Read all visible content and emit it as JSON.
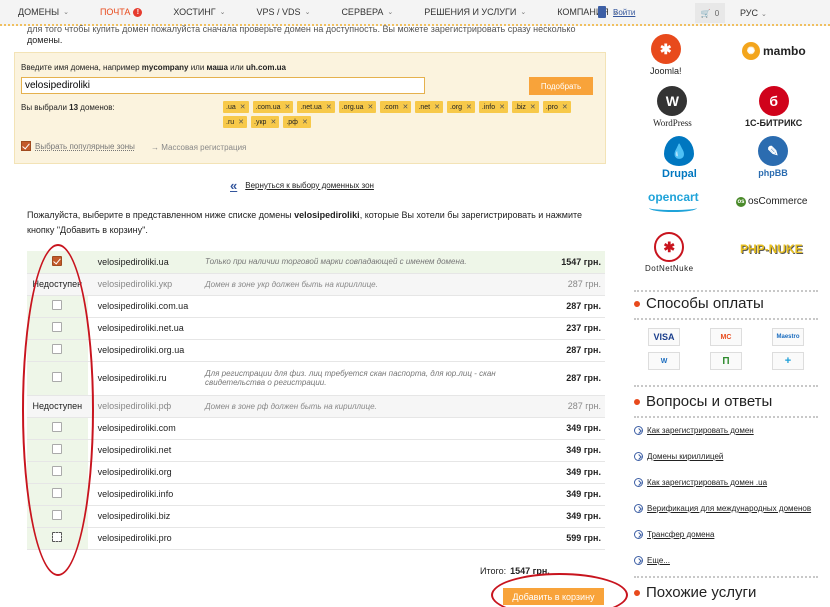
{
  "nav": {
    "items": [
      {
        "label": "ДОМЕНЫ"
      },
      {
        "label": "ПОЧТА"
      },
      {
        "label": "ХОСТИНГ"
      },
      {
        "label": "VPS / VDS"
      },
      {
        "label": "СЕРВЕРА"
      },
      {
        "label": "РЕШЕНИЯ И УСЛУГИ"
      },
      {
        "label": "КОМПАНИЯ"
      }
    ],
    "mail_badge": "!",
    "login": "Войти",
    "cart_count": "0",
    "lang": "РУС"
  },
  "intro": {
    "cut_text": "для того чтобы купить домен пожалуйста сначала проверьте домен на доступность. Вы можете зарегистрировать сразу несколько",
    "cut_text_2": "домены."
  },
  "search": {
    "hint_pre": "Введите имя домена, например ",
    "hint_ex1": "mycompany",
    "hint_mid1": " или ",
    "hint_ex2": "маша",
    "hint_mid2": " или ",
    "hint_ex3": "uh.com.ua",
    "value": "velosipediroliki",
    "button": "Подобрать",
    "chosen_pre": "Вы выбрали ",
    "chosen_count": "13",
    "chosen_post": " доменов:",
    "zones": [
      ".ua",
      ".com.ua",
      ".net.ua",
      ".org.ua",
      ".com",
      ".net",
      ".org",
      ".info",
      ".biz",
      ".pro",
      ".ru",
      ".укр",
      ".рф"
    ],
    "popular_label": "Выбрать популярные зоны",
    "mass_label": "Массовая регистрация",
    "mass_arrow": "→"
  },
  "back": {
    "label": "Вернуться к выбору доменных зон",
    "icon": "«"
  },
  "instructions": {
    "pre": "Пожалуйста, выберите в представленном ниже списке домены ",
    "name": "velosipediroliki",
    "post": ", которые Вы хотели бы зарегистрировать и нажмите кнопку \"Добавить в корзину\"."
  },
  "rows": [
    {
      "status": "checked",
      "domain": "velosipediroliki.ua",
      "note": "Только при наличии торговой марки совпадающей с именем домена.",
      "price": "1547 грн."
    },
    {
      "status": "unavailable",
      "label": "Недоступен",
      "domain": "velosipediroliki.укр",
      "note": "Домен в зоне укр должен быть на кириллице.",
      "price": "287 грн."
    },
    {
      "status": "open",
      "domain": "velosipediroliki.com.ua",
      "note": "",
      "price": "287 грн."
    },
    {
      "status": "open",
      "domain": "velosipediroliki.net.ua",
      "note": "",
      "price": "237 грн."
    },
    {
      "status": "open",
      "domain": "velosipediroliki.org.ua",
      "note": "",
      "price": "287 грн."
    },
    {
      "status": "open",
      "domain": "velosipediroliki.ru",
      "note": "Для регистрации для физ. лиц требуется скан паспорта, для юр.лиц - скан свидетельства о регистрации.",
      "price": "287 грн."
    },
    {
      "status": "unavailable",
      "label": "Недоступен",
      "domain": "velosipediroliki.рф",
      "note": "Домен в зоне рф должен быть на кириллице.",
      "price": "287 грн."
    },
    {
      "status": "open",
      "domain": "velosipediroliki.com",
      "note": "",
      "price": "349 грн."
    },
    {
      "status": "open",
      "domain": "velosipediroliki.net",
      "note": "",
      "price": "349 грн."
    },
    {
      "status": "open",
      "domain": "velosipediroliki.org",
      "note": "",
      "price": "349 грн."
    },
    {
      "status": "open",
      "domain": "velosipediroliki.info",
      "note": "",
      "price": "349 грн."
    },
    {
      "status": "open",
      "domain": "velosipediroliki.biz",
      "note": "",
      "price": "349 грн."
    },
    {
      "status": "focused",
      "domain": "velosipediroliki.pro",
      "note": "",
      "price": "599 грн."
    }
  ],
  "total": {
    "label": "Итого:",
    "value": "1547 грн."
  },
  "add_button": "Добавить в корзину",
  "sidebar": {
    "cms": [
      {
        "name": "Joomla!",
        "icon": "joomla-icon",
        "color": "#e84a1c"
      },
      {
        "name": "mambo",
        "icon": "mambo-icon",
        "color": "#f3a51c"
      },
      {
        "name": "WordPress",
        "icon": "wordpress-icon",
        "color": "#333333"
      },
      {
        "name": "1С-БИТРИКС",
        "icon": "bitrix-icon",
        "color": "#d0021b"
      },
      {
        "name": "Drupal",
        "icon": "drupal-icon",
        "color": "#0077c0"
      },
      {
        "name": "phpBB",
        "icon": "phpbb-icon",
        "color": "#2b6cb0"
      },
      {
        "name": "opencart",
        "icon": "opencart-icon",
        "color": "#1fa3d9"
      },
      {
        "name": "osCommerce",
        "icon": "oscommerce-icon",
        "color": "#4a8a2a"
      },
      {
        "name": "DotNetNuke",
        "icon": "dotnetnuke-icon",
        "color": "#c8141e"
      },
      {
        "name": "PHP-NUKE",
        "icon": "phpnuke-icon",
        "color": "#e8c020"
      }
    ],
    "payments_title": "Способы оплаты",
    "payments": [
      {
        "label": "VISA",
        "color": "#1a3e8c"
      },
      {
        "label": "MC",
        "color": "#e84a1c"
      },
      {
        "label": "Maestro",
        "color": "#1a6cbf"
      },
      {
        "label": "W",
        "color": "#1a6cbf"
      },
      {
        "label": "П",
        "color": "#2e8b2e"
      },
      {
        "label": "+",
        "color": "#1a9ed8"
      }
    ],
    "faq_title": "Вопросы и ответы",
    "faq": [
      "Как зарегистрировать домен",
      "Домены кириллицей",
      "Как зарегистрировать домен .ua",
      "Верификация для международных доменов",
      "Трансфер домена",
      "Еще..."
    ],
    "similar_title": "Похожие услуги"
  }
}
